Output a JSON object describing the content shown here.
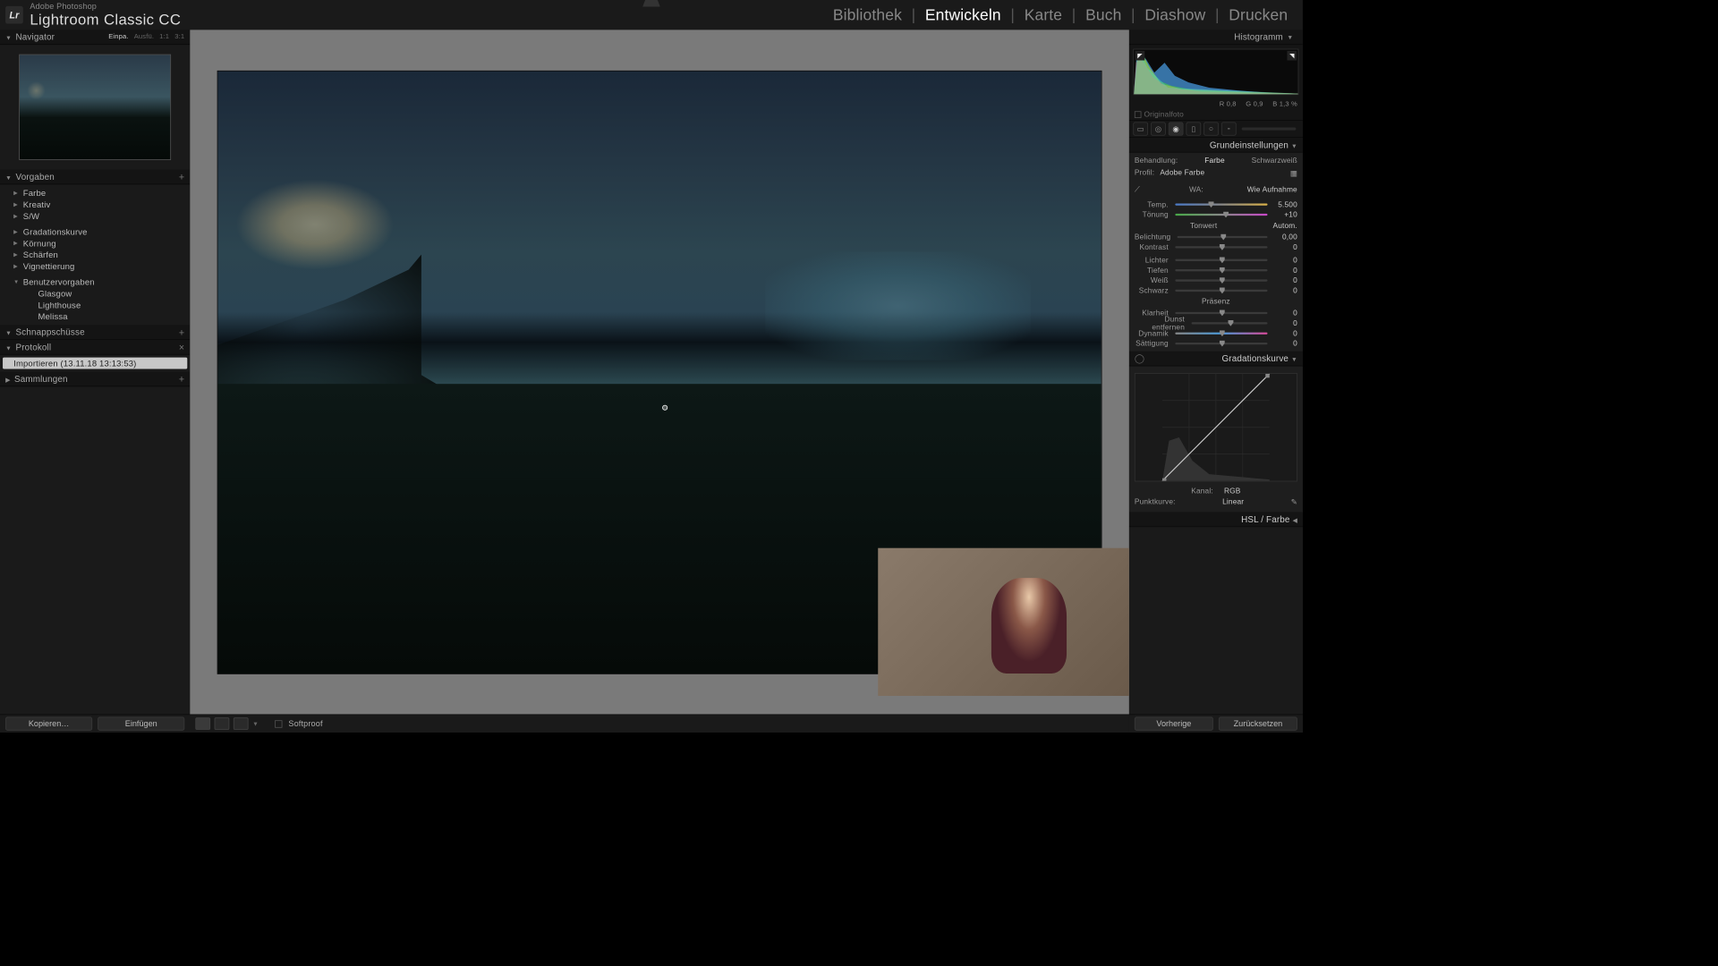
{
  "app": {
    "subtitle": "Adobe Photoshop",
    "name": "Lightroom Classic CC"
  },
  "modules": {
    "library": "Bibliothek",
    "develop": "Entwickeln",
    "map": "Karte",
    "book": "Buch",
    "slideshow": "Diashow",
    "print": "Drucken"
  },
  "nav": {
    "title": "Navigator",
    "fit": "Einpa.",
    "fill": "Ausfü.",
    "z1": "1:1",
    "z2": "3:1"
  },
  "presets": {
    "title": "Vorgaben",
    "items": [
      "Farbe",
      "Kreativ",
      "S/W"
    ],
    "group2": [
      "Gradationskurve",
      "Körnung",
      "Schärfen",
      "Vignettierung"
    ],
    "user_head": "Benutzervorgaben",
    "user": [
      "Glasgow",
      "Lighthouse",
      "Melissa"
    ]
  },
  "snapshots": {
    "title": "Schnappschüsse"
  },
  "history": {
    "title": "Protokoll",
    "item": "Importieren (13.11.18 13:13:53)"
  },
  "collections": {
    "title": "Sammlungen"
  },
  "histogram": {
    "title": "Histogramm",
    "r": "0,8",
    "g": "0,9",
    "b": "1,3 %",
    "rlabel": "R",
    "glabel": "G",
    "blabel": "B",
    "original": "Originalfoto"
  },
  "basic": {
    "title": "Grundeinstellungen",
    "treatment": "Behandlung:",
    "color": "Farbe",
    "bw": "Schwarzweiß",
    "profile_l": "Profil:",
    "profile": "Adobe Farbe",
    "wb_l": "WA:",
    "wb": "Wie Aufnahme",
    "temp_l": "Temp.",
    "temp_v": "5.500",
    "tint_l": "Tönung",
    "tint_v": "+10",
    "tone_h": "Tonwert",
    "auto": "Autom.",
    "exp_l": "Belichtung",
    "exp_v": "0,00",
    "con_l": "Kontrast",
    "con_v": "0",
    "hi_l": "Lichter",
    "hi_v": "0",
    "sh_l": "Tiefen",
    "sh_v": "0",
    "wh_l": "Weiß",
    "wh_v": "0",
    "bl_l": "Schwarz",
    "bl_v": "0",
    "pres_h": "Präsenz",
    "clar_l": "Klarheit",
    "clar_v": "0",
    "dehz_l": "Dunst entfernen",
    "dehz_v": "0",
    "vib_l": "Dynamik",
    "vib_v": "0",
    "sat_l": "Sättigung",
    "sat_v": "0"
  },
  "curve": {
    "title": "Gradationskurve",
    "channel_l": "Kanal:",
    "channel": "RGB",
    "point_l": "Punktkurve:",
    "point": "Linear"
  },
  "hsl": {
    "title": "HSL / Farbe"
  },
  "toolbar": {
    "softproof": "Softproof"
  },
  "footer_left": {
    "copy": "Kopieren…",
    "paste": "Einfügen"
  },
  "footer_right": {
    "prev": "Vorherige",
    "reset": "Zurücksetzen"
  }
}
